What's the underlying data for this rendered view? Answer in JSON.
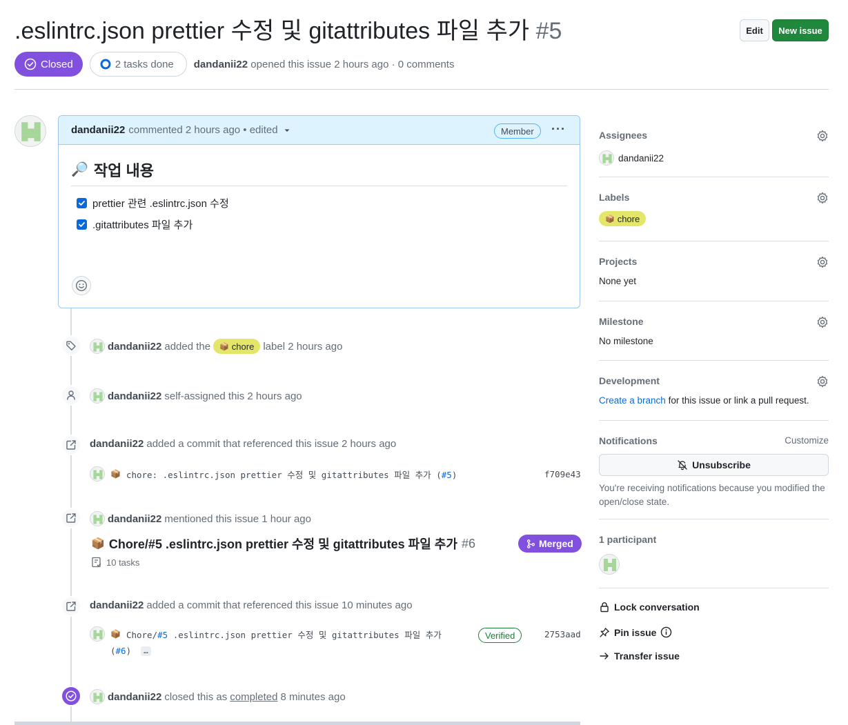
{
  "issue": {
    "title": ".eslintrc.json prettier 수정 및 gitattributes 파일 추가",
    "number": "#5",
    "state": "Closed",
    "tasks": "2 tasks done",
    "author": "dandanii22",
    "meta_suffix": "opened this issue 2 hours ago · 0 comments"
  },
  "header_buttons": {
    "edit": "Edit",
    "new_issue": "New issue"
  },
  "comment": {
    "author": "dandanii22",
    "meta": "commented 2 hours ago • edited",
    "role": "Member",
    "heading_emoji": "🔎",
    "heading": "작업 내용",
    "tasks": [
      "prettier 관련 .eslintrc.json 수정",
      ".gitattributes 파일 추가"
    ]
  },
  "timeline": {
    "label_event": {
      "user": "dandanii22",
      "pre": "added the",
      "label": "chore",
      "post": "label 2 hours ago"
    },
    "assign_event": {
      "user": "dandanii22",
      "text": "self-assigned this 2 hours ago"
    },
    "commit_event_1": {
      "user": "dandanii22",
      "text": "added a commit that referenced this issue 2 hours ago",
      "commit_msg": "chore: .eslintrc.json prettier 수정 및 gitattributes 파일 추가 (",
      "commit_ref": "#5",
      "commit_close": ")",
      "sha": "f709e43"
    },
    "mention_event": {
      "user": "dandanii22",
      "text": "mentioned this issue 1 hour ago",
      "pr_title": "Chore/#5 .eslintrc.json prettier 수정 및 gitattributes 파일 추가",
      "pr_number": "#6",
      "pr_state": "Merged",
      "pr_tasks": "10 tasks"
    },
    "commit_event_2": {
      "user": "dandanii22",
      "text": "added a commit that referenced this issue 10 minutes ago",
      "commit_pre": "Chore/",
      "commit_ref": "#5",
      "commit_msg": " .eslintrc.json prettier 수정 및 gitattributes 파일 추가",
      "commit_line2_open": "(",
      "commit_ref2": "#6",
      "commit_line2_close": ")",
      "ellipsis": "…",
      "verified": "Verified",
      "sha": "2753aad"
    },
    "close_event": {
      "user": "dandanii22",
      "pre": "closed this as",
      "link": "completed",
      "post": "8 minutes ago"
    }
  },
  "sidebar": {
    "assignees": {
      "heading": "Assignees",
      "value": "dandanii22"
    },
    "labels": {
      "heading": "Labels",
      "value": "chore"
    },
    "projects": {
      "heading": "Projects",
      "value": "None yet"
    },
    "milestone": {
      "heading": "Milestone",
      "value": "No milestone"
    },
    "development": {
      "heading": "Development",
      "link": "Create a branch",
      "suffix": " for this issue or link a pull request."
    },
    "notifications": {
      "heading": "Notifications",
      "customize": "Customize",
      "button": "Unsubscribe",
      "note": "You're receiving notifications because you modified the open/close state."
    },
    "participants": {
      "heading": "1 participant"
    },
    "actions": {
      "lock": "Lock conversation",
      "pin": "Pin issue",
      "transfer": "Transfer issue"
    }
  },
  "colors": {
    "closed_purple": "#8250df",
    "label_chore": "#e4e669",
    "primary_green": "#1f883d",
    "link_blue": "#0969da"
  }
}
